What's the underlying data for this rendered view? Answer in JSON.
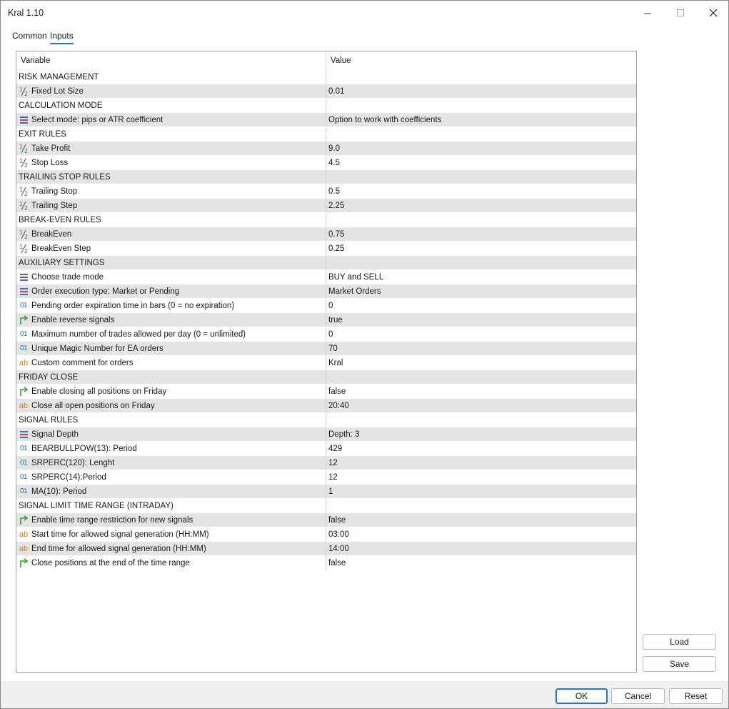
{
  "window": {
    "title": "Kral 1.10"
  },
  "tabs": [
    {
      "label": "Common",
      "active": false
    },
    {
      "label": "Inputs",
      "active": true
    }
  ],
  "grid": {
    "headers": {
      "variable": "Variable",
      "value": "Value"
    },
    "rows": [
      {
        "type": "section",
        "label": "RISK MANAGEMENT"
      },
      {
        "type": "param",
        "icon": "fraction-icon",
        "label": "Fixed Lot Size",
        "value": "0.01"
      },
      {
        "type": "section",
        "label": "CALCULATION MODE"
      },
      {
        "type": "param",
        "icon": "enum-list-icon",
        "label": "Select mode: pips or ATR coefficient",
        "value": "Option to work with coefficients"
      },
      {
        "type": "section",
        "label": "EXIT RULES"
      },
      {
        "type": "param",
        "icon": "fraction-icon",
        "label": "Take Profit",
        "value": "9.0"
      },
      {
        "type": "param",
        "icon": "fraction-icon",
        "label": "Stop Loss",
        "value": "4.5"
      },
      {
        "type": "section",
        "label": "TRAILING STOP RULES"
      },
      {
        "type": "param",
        "icon": "fraction-icon",
        "label": "Trailing Stop",
        "value": "0.5"
      },
      {
        "type": "param",
        "icon": "fraction-icon",
        "label": "Trailing Step",
        "value": "2.25"
      },
      {
        "type": "section",
        "label": "BREAK-EVEN RULES"
      },
      {
        "type": "param",
        "icon": "fraction-icon",
        "label": "BreakEven",
        "value": "0.75"
      },
      {
        "type": "param",
        "icon": "fraction-icon",
        "label": "BreakEven Step",
        "value": "0.25"
      },
      {
        "type": "section",
        "label": "AUXILIARY SETTINGS"
      },
      {
        "type": "param",
        "icon": "enum-list-icon",
        "label": "Choose trade mode",
        "value": "BUY and SELL"
      },
      {
        "type": "param",
        "icon": "enum-list-icon",
        "label": "Order execution type: Market or Pending",
        "value": "Market Orders"
      },
      {
        "type": "param",
        "icon": "integer-icon",
        "label": "Pending order expiration time in bars (0 = no expiration)",
        "value": "0"
      },
      {
        "type": "param",
        "icon": "bool-arrow-icon",
        "label": "Enable reverse signals",
        "value": "true"
      },
      {
        "type": "param",
        "icon": "integer-icon",
        "label": "Maximum number of trades allowed per day (0 = unlimited)",
        "value": "0"
      },
      {
        "type": "param",
        "icon": "integer-icon",
        "label": "Unique Magic Number for EA orders",
        "value": "70"
      },
      {
        "type": "param",
        "icon": "string-icon",
        "label": "Custom comment for orders",
        "value": "Kral"
      },
      {
        "type": "section",
        "label": "FRIDAY CLOSE"
      },
      {
        "type": "param",
        "icon": "bool-arrow-icon",
        "label": "Enable closing all positions on Friday",
        "value": "false"
      },
      {
        "type": "param",
        "icon": "string-icon",
        "label": "Close all open positions on Friday",
        "value": "20:40"
      },
      {
        "type": "section",
        "label": "SIGNAL RULES"
      },
      {
        "type": "param",
        "icon": "enum-list-icon",
        "label": "Signal Depth",
        "value": "Depth: 3"
      },
      {
        "type": "param",
        "icon": "integer-icon",
        "label": "BEARBULLPOW(13): Period",
        "value": "429"
      },
      {
        "type": "param",
        "icon": "integer-icon",
        "label": "SRPERC(120): Lenght",
        "value": "12"
      },
      {
        "type": "param",
        "icon": "integer-icon",
        "label": "SRPERC(14):Period",
        "value": "12"
      },
      {
        "type": "param",
        "icon": "integer-icon",
        "label": "MA(10): Period",
        "value": "1"
      },
      {
        "type": "section",
        "label": "SIGNAL LIMIT TIME RANGE (INTRADAY)"
      },
      {
        "type": "param",
        "icon": "bool-arrow-icon",
        "label": "Enable time range restriction for new signals",
        "value": "false"
      },
      {
        "type": "param",
        "icon": "string-icon",
        "label": "Start time for allowed signal generation (HH:MM)",
        "value": "03:00"
      },
      {
        "type": "param",
        "icon": "string-icon",
        "label": "End time for allowed signal generation (HH:MM)",
        "value": "14:00"
      },
      {
        "type": "param",
        "icon": "bool-arrow-icon",
        "label": "Close positions at the end of the time range",
        "value": "false"
      }
    ]
  },
  "side_buttons": {
    "load": "Load",
    "save": "Save"
  },
  "footer": {
    "ok": "OK",
    "cancel": "Cancel",
    "reset": "Reset"
  },
  "colors": {
    "accent": "#2a6fd6",
    "row_shade": "#e4e4e4",
    "integer_icon": "#1f6fd0",
    "string_icon": "#c08a12",
    "bool_icon": "#2e9e3a",
    "enum_icon_red": "#d2403a",
    "enum_icon_blue": "#3a6fc8"
  }
}
